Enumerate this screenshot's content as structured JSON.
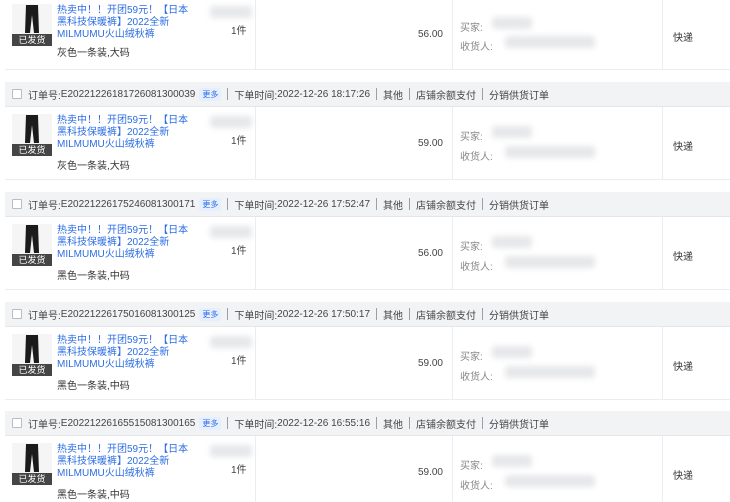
{
  "labels": {
    "order_no": "订单号:",
    "more": "更多",
    "time": "下单时间:",
    "pay_type": "其他",
    "pay_method": "店铺余额支付",
    "order_type": "分销供货订单",
    "status": "已发货",
    "buyer": "买家:",
    "receiver": "收货人:",
    "shipping": "快递"
  },
  "orders": [
    {
      "order_no": "",
      "time": "",
      "title": "热卖中！！开团59元！【日本黑科技保暖裤】2022全新 MILMUMU火山绒秋裤",
      "spec": "灰色一条装,大码",
      "qty": "1件",
      "price": "56.00"
    },
    {
      "order_no": "E20221226181726081300039",
      "time": "2022-12-26 18:17:26",
      "title": "热卖中！！开团59元！【日本黑科技保暖裤】2022全新 MILMUMU火山绒秋裤",
      "spec": "灰色一条装,大码",
      "qty": "1件",
      "price": "59.00"
    },
    {
      "order_no": "E20221226175246081300171",
      "time": "2022-12-26 17:52:47",
      "title": "热卖中！！开团59元！【日本黑科技保暖裤】2022全新 MILMUMU火山绒秋裤",
      "spec": "黑色一条装,中码",
      "qty": "1件",
      "price": "56.00"
    },
    {
      "order_no": "E20221226175016081300125",
      "time": "2022-12-26 17:50:17",
      "title": "热卖中！！开团59元！【日本黑科技保暖裤】2022全新 MILMUMU火山绒秋裤",
      "spec": "黑色一条装,中码",
      "qty": "1件",
      "price": "59.00"
    },
    {
      "order_no": "E20221226165515081300165",
      "time": "2022-12-26 16:55:16",
      "title": "热卖中！！开团59元！【日本黑科技保暖裤】2022全新 MILMUMU火山绒秋裤",
      "spec": "黑色一条装,中码",
      "qty": "1件",
      "price": "59.00"
    }
  ]
}
